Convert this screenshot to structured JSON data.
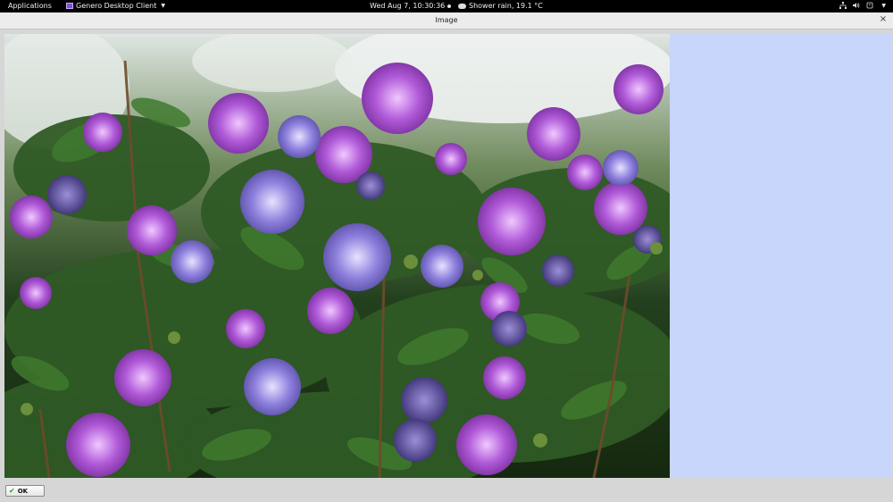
{
  "topbar": {
    "applications_label": "Applications",
    "app_name": "Genero Desktop Client",
    "clock": "Wed Aug  7, 10:30:36",
    "weather": "Shower rain, 19.1 °C"
  },
  "window": {
    "title": "Image",
    "close_symbol": "×"
  },
  "image": {
    "description_icon": "flower-photo",
    "side_panel_color": "#c8d5fb"
  },
  "footer": {
    "ok_label": "OK"
  },
  "icons": [
    "app-icon",
    "chevron-down-icon",
    "clock-dot-icon",
    "weather-cloud-icon",
    "network-icon",
    "volume-icon",
    "power-icon",
    "close-icon",
    "checkmark-icon"
  ]
}
